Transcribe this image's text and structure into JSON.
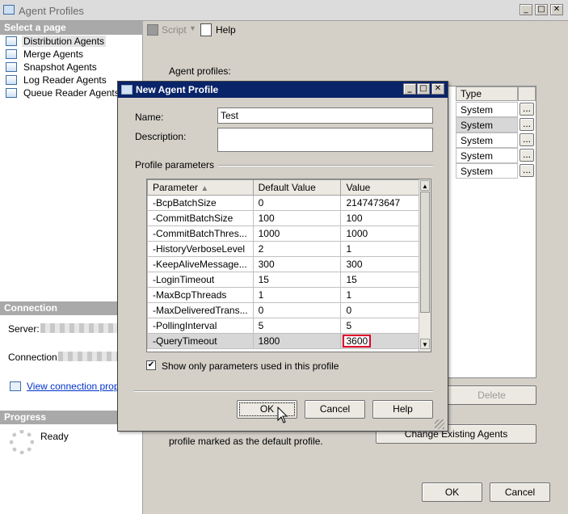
{
  "window": {
    "title": "Agent Profiles",
    "buttons": [
      "_",
      "□",
      "✕"
    ]
  },
  "left_pane": {
    "select_page_header": "Select a page",
    "pages": [
      {
        "label": "Distribution Agents",
        "selected": true
      },
      {
        "label": "Merge Agents",
        "selected": false
      },
      {
        "label": "Snapshot Agents",
        "selected": false
      },
      {
        "label": "Log Reader Agents",
        "selected": false
      },
      {
        "label": "Queue Reader Agents",
        "selected": false
      }
    ],
    "connection_header": "Connection",
    "server_label": "Server:",
    "connection_label": "Connection:",
    "view_connection_link": "View connection prope",
    "progress_header": "Progress",
    "progress_status": "Ready"
  },
  "toolbar": {
    "script_label": "Script",
    "help_label": "Help"
  },
  "main": {
    "agent_profiles_label": "Agent profiles:",
    "type_header": "Type",
    "types": [
      "System",
      "System",
      "System",
      "System",
      "System"
    ],
    "row_button": "...",
    "delete_label": "Delete",
    "change_agents_label": "Change Existing Agents",
    "default_profile_text": "profile marked as the default profile.",
    "ok_label": "OK",
    "cancel_label": "Cancel"
  },
  "dialog": {
    "title": "New Agent Profile",
    "name_label": "Name:",
    "name_value": "Test",
    "description_label": "Description:",
    "description_value": "",
    "profile_parameters_label": "Profile parameters",
    "columns": [
      "Parameter",
      "Default Value",
      "Value"
    ],
    "rows": [
      [
        "-BcpBatchSize",
        "0",
        "2147473647"
      ],
      [
        "-CommitBatchSize",
        "100",
        "100"
      ],
      [
        "-CommitBatchThres...",
        "1000",
        "1000"
      ],
      [
        "-HistoryVerboseLevel",
        "2",
        "1"
      ],
      [
        "-KeepAliveMessage...",
        "300",
        "300"
      ],
      [
        "-LoginTimeout",
        "15",
        "15"
      ],
      [
        "-MaxBcpThreads",
        "1",
        "1"
      ],
      [
        "-MaxDeliveredTrans...",
        "0",
        "0"
      ],
      [
        "-PollingInterval",
        "5",
        "5"
      ],
      [
        "-QueryTimeout",
        "1800",
        "3600"
      ]
    ],
    "show_only_label": "Show only parameters used in this profile",
    "show_only_checked": true,
    "ok_label": "OK",
    "cancel_label": "Cancel",
    "help_label": "Help"
  }
}
